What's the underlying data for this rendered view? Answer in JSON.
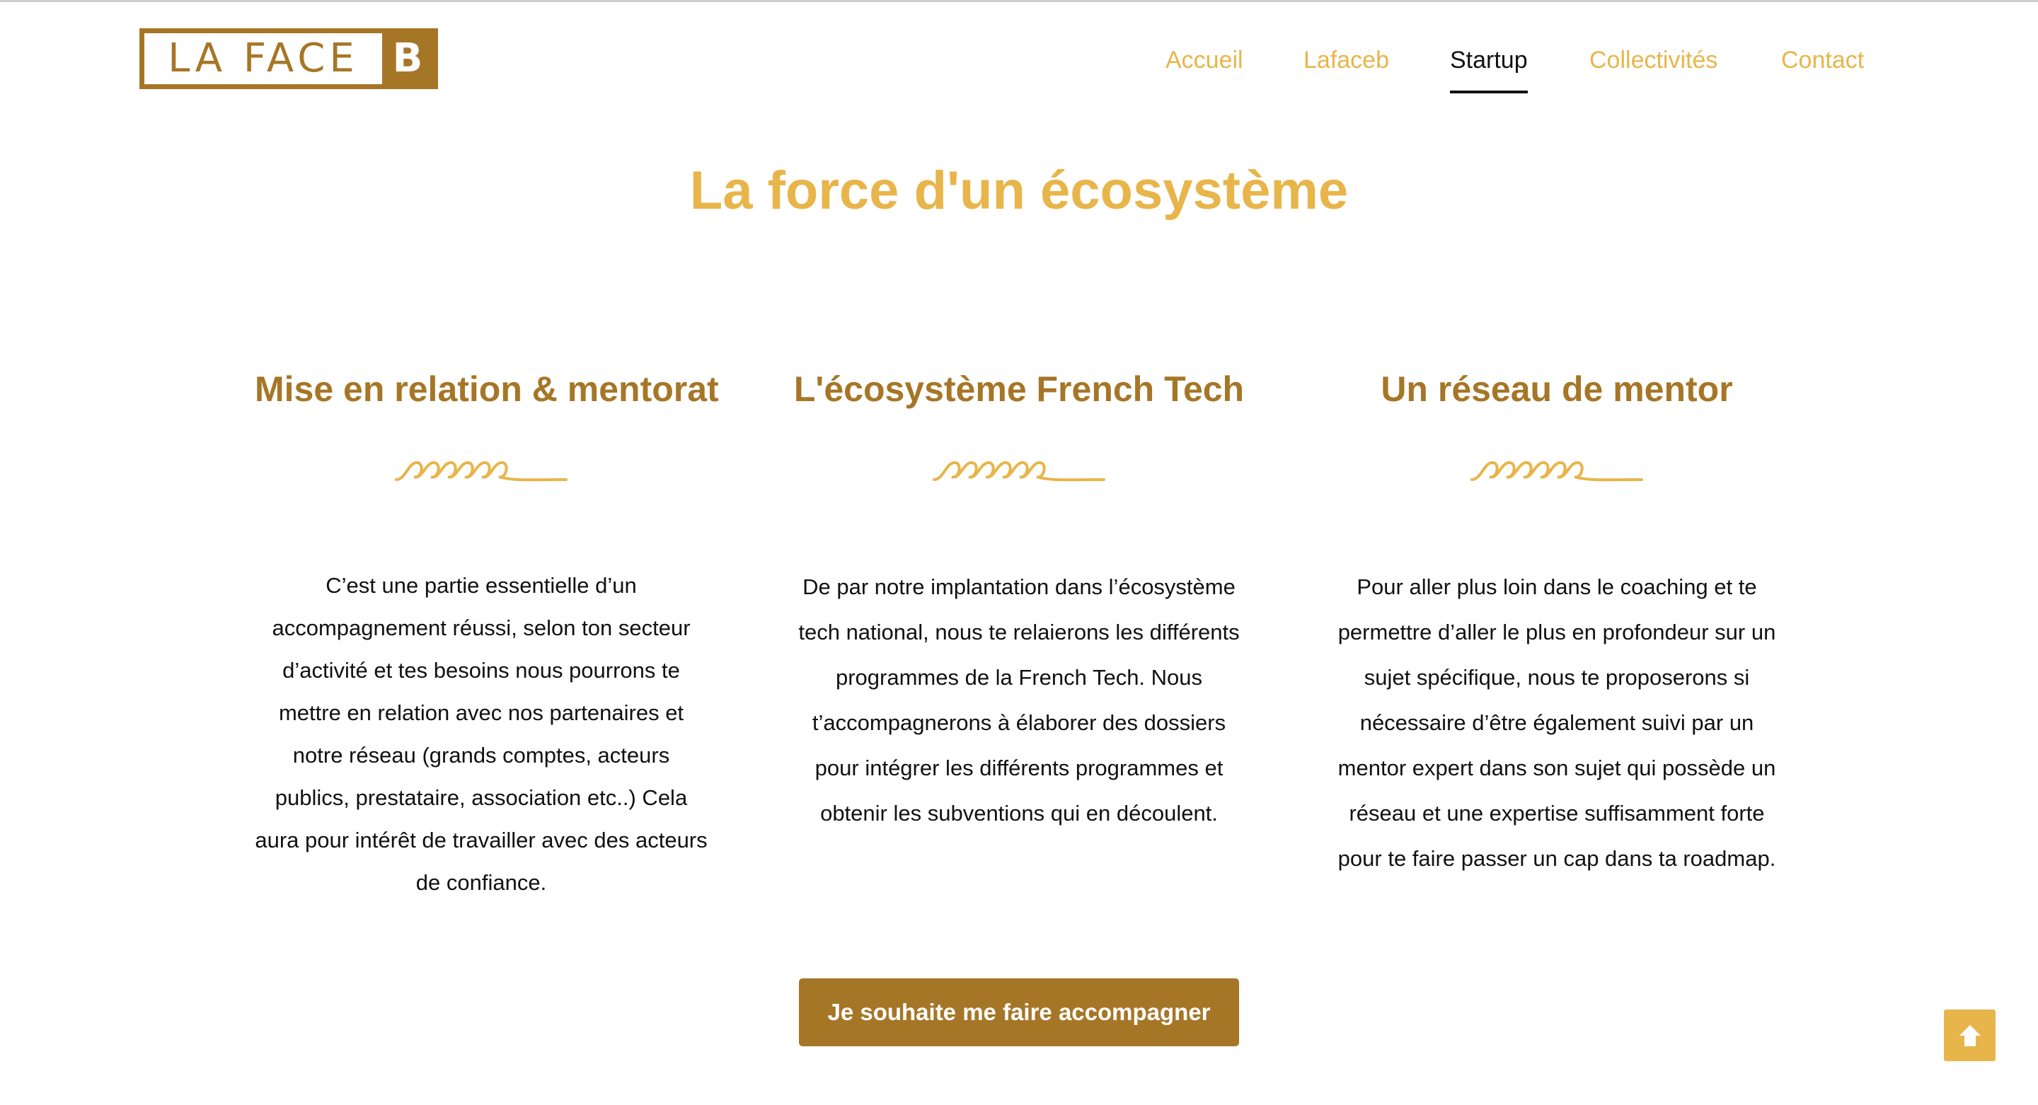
{
  "header": {
    "logo": {
      "main_text": "LA FACE",
      "badge_text": "B"
    },
    "nav": [
      {
        "label": "Accueil",
        "active": false
      },
      {
        "label": "Lafaceb",
        "active": false
      },
      {
        "label": "Startup",
        "active": true
      },
      {
        "label": "Collectivités",
        "active": false
      },
      {
        "label": "Contact",
        "active": false
      }
    ]
  },
  "main": {
    "title": "La force d'un écosystème",
    "columns": [
      {
        "heading": "Mise en relation & mentorat",
        "text": "C’est une partie essentielle d’un accompagnement réussi, selon ton secteur d’activité et tes besoins nous pourrons te mettre en relation avec nos partenaires et notre réseau (grands comptes, acteurs publics, prestataire, association etc..) Cela aura pour intérêt de travailler avec des acteurs de confiance."
      },
      {
        "heading": "L'écosystème French Tech",
        "text": "De par notre implantation dans l’écosystème tech national, nous te relaierons les différents programmes de la French Tech. Nous t’accompagnerons à élaborer des dossiers pour intégrer les différents programmes et obtenir les subventions qui en découlent."
      },
      {
        "heading": "Un réseau de mentor",
        "text": "Pour aller plus loin dans le coaching et te permettre d’aller le plus en profondeur sur un sujet spécifique, nous te proposerons si nécessaire d’être également suivi par un mentor expert dans son sujet qui possède un réseau et une expertise suffisamment forte pour te faire passer un cap dans ta roadmap."
      }
    ],
    "cta_label": "Je souhaite me faire accompagner"
  },
  "scroll_top_icon": "arrow-up-icon",
  "colors": {
    "accent_gold": "#e8b54a",
    "brand_brown": "#a67627",
    "text": "#111111",
    "background": "#ffffff"
  }
}
